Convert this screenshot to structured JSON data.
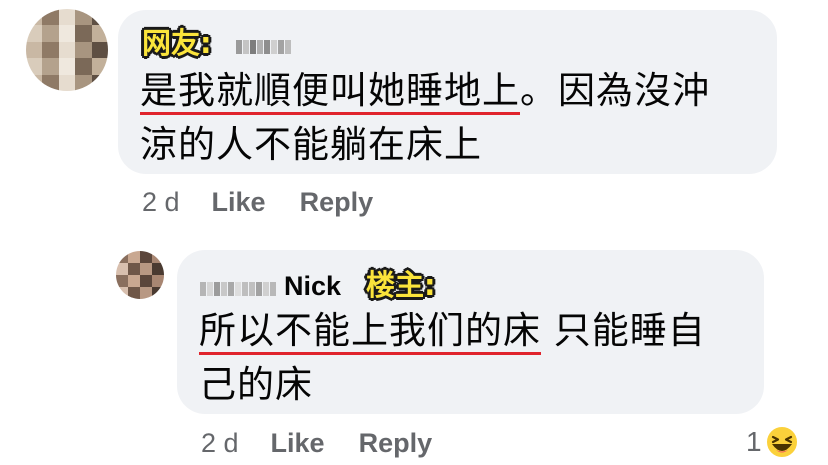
{
  "comments": [
    {
      "tag": "网友:",
      "text_line1_underlined": "是我就順便叫她睡地上",
      "text_line1_rest": "。因為沒沖",
      "text_line2": "涼的人不能躺在床上",
      "time": "2 d",
      "like_label": "Like",
      "reply_label": "Reply"
    },
    {
      "author": "Nick",
      "tag": "楼主:",
      "text_line1_underlined": "所以不能上我们的床",
      "text_line1_rest": " 只能睡自",
      "text_line2": "己的床",
      "time": "2 d",
      "like_label": "Like",
      "reply_label": "Reply",
      "reaction_count": "1",
      "reaction_emoji": "😆"
    }
  ],
  "colors": {
    "bubble": "#f0f2f5",
    "underline": "#e0242c",
    "tag": "#fbe43b",
    "meta": "#65676b"
  },
  "icons": {
    "reaction": "laughing-face-icon"
  }
}
